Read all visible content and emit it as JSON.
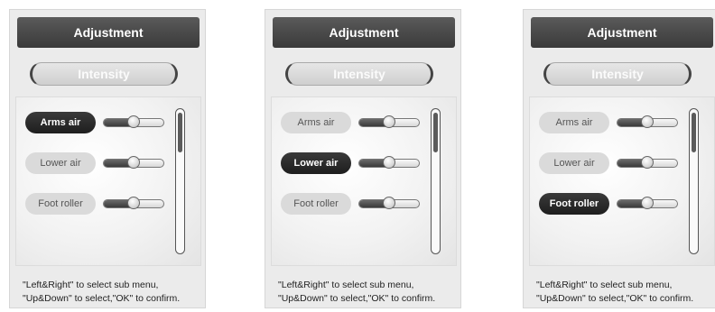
{
  "panels": [
    {
      "title": "Adjustment",
      "intensity_label": "Intensity",
      "items": [
        {
          "label": "Arms air",
          "active": true,
          "level": 0.5
        },
        {
          "label": "Lower air",
          "active": false,
          "level": 0.5
        },
        {
          "label": "Foot roller",
          "active": false,
          "level": 0.5
        }
      ],
      "help_line1": "\"Left&Right\" to select sub menu,",
      "help_line2": "\"Up&Down\" to select,\"OK\" to confirm."
    },
    {
      "title": "Adjustment",
      "intensity_label": "Intensity",
      "items": [
        {
          "label": "Arms air",
          "active": false,
          "level": 0.5
        },
        {
          "label": "Lower air",
          "active": true,
          "level": 0.5
        },
        {
          "label": "Foot roller",
          "active": false,
          "level": 0.5
        }
      ],
      "help_line1": "\"Left&Right\" to select sub menu,",
      "help_line2": "\"Up&Down\" to select,\"OK\" to confirm."
    },
    {
      "title": "Adjustment",
      "intensity_label": "Intensity",
      "items": [
        {
          "label": "Arms air",
          "active": false,
          "level": 0.5
        },
        {
          "label": "Lower air",
          "active": false,
          "level": 0.5
        },
        {
          "label": "Foot roller",
          "active": true,
          "level": 0.5
        }
      ],
      "help_line1": "\"Left&Right\" to select sub menu,",
      "help_line2": "\"Up&Down\" to select,\"OK\" to confirm."
    }
  ],
  "colors": {
    "title_bar": "#444444",
    "active_pill": "#2a2a2a",
    "inactive_pill": "#dadada"
  }
}
